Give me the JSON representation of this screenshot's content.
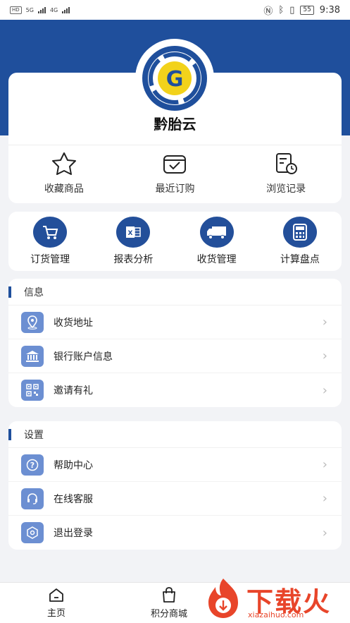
{
  "status_bar": {
    "hd1": "HD",
    "hd2": "HD",
    "net1": "5G",
    "net2": "4G",
    "battery": "55",
    "time": "9:38"
  },
  "profile": {
    "app_name": "黔胎云"
  },
  "quick_actions": [
    {
      "label": "收藏商品",
      "icon": "star-icon"
    },
    {
      "label": "最近订购",
      "icon": "box-check-icon"
    },
    {
      "label": "浏览记录",
      "icon": "history-icon"
    }
  ],
  "functions": [
    {
      "label": "订货管理",
      "icon": "cart-icon"
    },
    {
      "label": "报表分析",
      "icon": "excel-icon"
    },
    {
      "label": "收货管理",
      "icon": "truck-icon"
    },
    {
      "label": "计算盘点",
      "icon": "calculator-icon"
    }
  ],
  "info_section": {
    "title": "信息",
    "items": [
      {
        "label": "收货地址",
        "icon": "location-icon"
      },
      {
        "label": "银行账户信息",
        "icon": "bank-icon"
      },
      {
        "label": "邀请有礼",
        "icon": "qrcode-icon"
      }
    ]
  },
  "settings_section": {
    "title": "设置",
    "items": [
      {
        "label": "帮助中心",
        "icon": "help-icon"
      },
      {
        "label": "在线客服",
        "icon": "headset-icon"
      },
      {
        "label": "退出登录",
        "icon": "logout-icon"
      }
    ]
  },
  "bottom_nav": [
    {
      "label": "主页",
      "icon": "home-icon"
    },
    {
      "label": "积分商城",
      "icon": "shopping-bag-icon"
    }
  ],
  "watermark": {
    "text": "下载火",
    "url": "xiazaihuo.com"
  },
  "colors": {
    "brand_blue": "#1f4f9c",
    "row_icon_blue": "#6c8fd2",
    "watermark_red": "#e8452a"
  }
}
